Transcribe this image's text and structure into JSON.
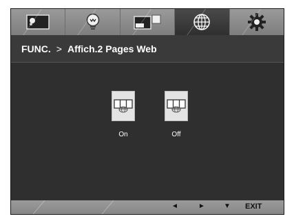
{
  "tabs": [
    {
      "icon": "picture-icon",
      "active": false
    },
    {
      "icon": "bulb-icon",
      "active": false
    },
    {
      "icon": "dual-screen-icon",
      "active": false
    },
    {
      "icon": "globe-icon",
      "active": true
    },
    {
      "icon": "gear-icon",
      "active": false
    }
  ],
  "title": {
    "section": "FUNC.",
    "separator": ">",
    "page": "Affich.2 Pages Web"
  },
  "options": [
    {
      "label": "On",
      "icon": "web-split-icon"
    },
    {
      "label": "Off",
      "icon": "web-split-icon"
    }
  ],
  "bottom": {
    "left": "◄",
    "right": "►",
    "down": "▼",
    "exit": "EXIT"
  },
  "colors": {
    "panel": "#2f2f2f",
    "tab_bar": "#8a8a8a",
    "active_tab": "#3a3a3a",
    "option_button": "#e4e4e4",
    "text": "#ffffff"
  }
}
